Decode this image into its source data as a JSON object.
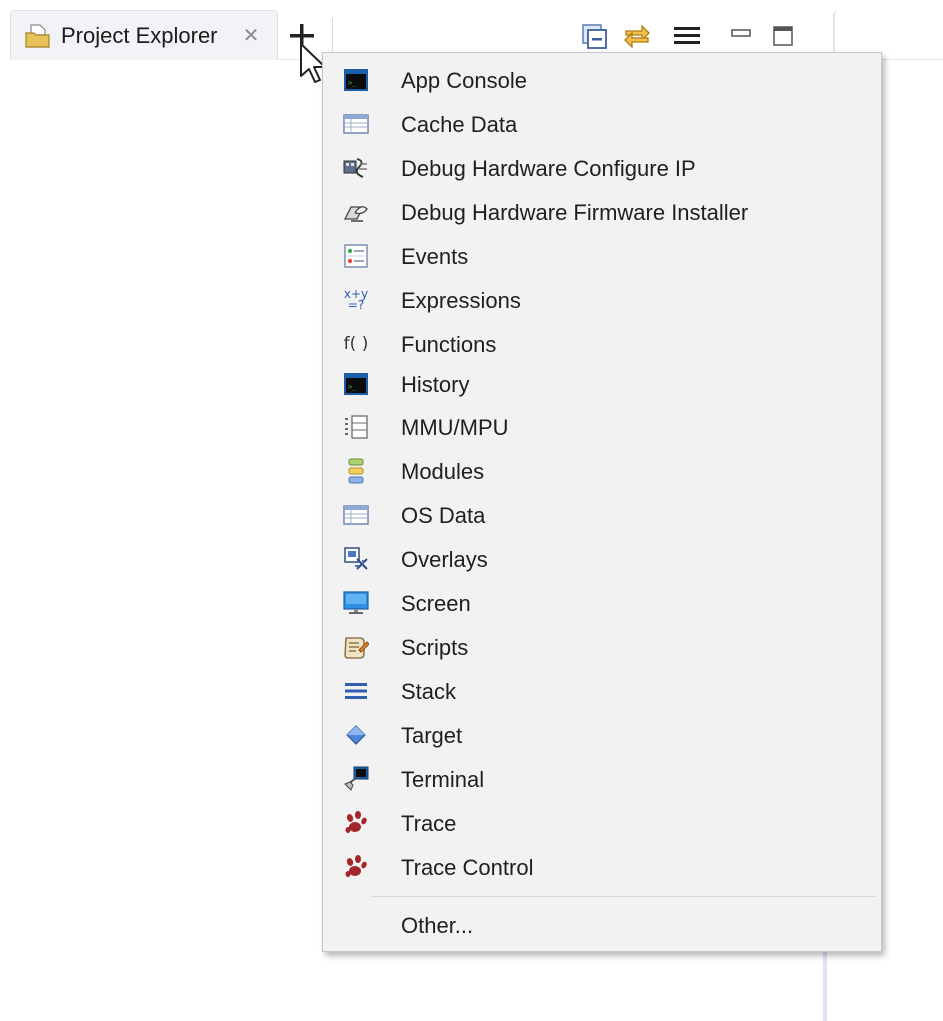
{
  "tab": {
    "label": "Project Explorer",
    "close_glyph": "✕"
  },
  "toolbar": {
    "icons": [
      "collapse-all-icon",
      "link-with-editor-icon",
      "view-menu-icon",
      "minimize-icon",
      "maximize-icon"
    ]
  },
  "menu": {
    "items": [
      {
        "label": "App Console",
        "icon": "console-icon"
      },
      {
        "label": "Cache Data",
        "icon": "table-icon"
      },
      {
        "label": "Debug Hardware Configure IP",
        "icon": "hardware-config-icon"
      },
      {
        "label": "Debug Hardware Firmware Installer",
        "icon": "firmware-installer-icon"
      },
      {
        "label": "Events",
        "icon": "events-icon"
      },
      {
        "label": "Expressions",
        "icon": "expressions-icon"
      },
      {
        "label": "Functions",
        "icon": "functions-icon"
      },
      {
        "label": "History",
        "icon": "console-icon"
      },
      {
        "label": "MMU/MPU",
        "icon": "mmu-icon"
      },
      {
        "label": "Modules",
        "icon": "modules-icon"
      },
      {
        "label": "OS Data",
        "icon": "table-icon"
      },
      {
        "label": "Overlays",
        "icon": "overlays-icon"
      },
      {
        "label": "Screen",
        "icon": "monitor-icon"
      },
      {
        "label": "Scripts",
        "icon": "scripts-icon"
      },
      {
        "label": "Stack",
        "icon": "stack-icon"
      },
      {
        "label": "Target",
        "icon": "target-icon"
      },
      {
        "label": "Terminal",
        "icon": "terminal-icon"
      },
      {
        "label": "Trace",
        "icon": "paw-icon"
      },
      {
        "label": "Trace Control",
        "icon": "paw-icon"
      }
    ],
    "other_label": "Other...",
    "expr_icon_top": "x+y",
    "expr_icon_bottom": "=?",
    "fn_icon_text": "f( )"
  }
}
